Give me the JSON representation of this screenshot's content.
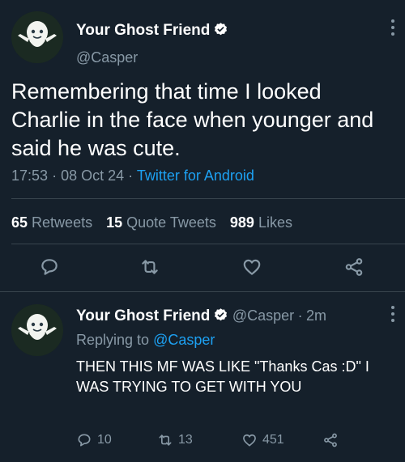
{
  "tweet": {
    "author_name": "Your Ghost Friend",
    "author_handle": "@Casper",
    "text": "Remembering that time I looked Charlie in the face when younger and said he was cute.",
    "time": "17:53",
    "date": "08 Oct 24",
    "source": "Twitter for Android",
    "separator": "·",
    "retweets_count": "65",
    "retweets_label": "Retweets",
    "quotes_count": "15",
    "quotes_label": "Quote Tweets",
    "likes_count": "989",
    "likes_label": "Likes"
  },
  "reply": {
    "author_name": "Your Ghost Friend",
    "author_handle": "@Casper",
    "age": "2m",
    "separator": "·",
    "replying_prefix": "Replying to",
    "replying_to": "@Casper",
    "text": "THEN THIS MF WAS LIKE \"Thanks Cas :D\" I WAS TRYING TO GET WITH YOU",
    "reply_count": "10",
    "retweet_count": "13",
    "like_count": "451"
  },
  "colors": {
    "background": "#15202b",
    "secondary_text": "#8899a6",
    "link": "#1da1f2",
    "divider": "#38444d"
  },
  "icons": [
    "verified-badge-icon",
    "more-menu-icon",
    "reply-icon",
    "retweet-icon",
    "like-icon",
    "share-icon"
  ]
}
